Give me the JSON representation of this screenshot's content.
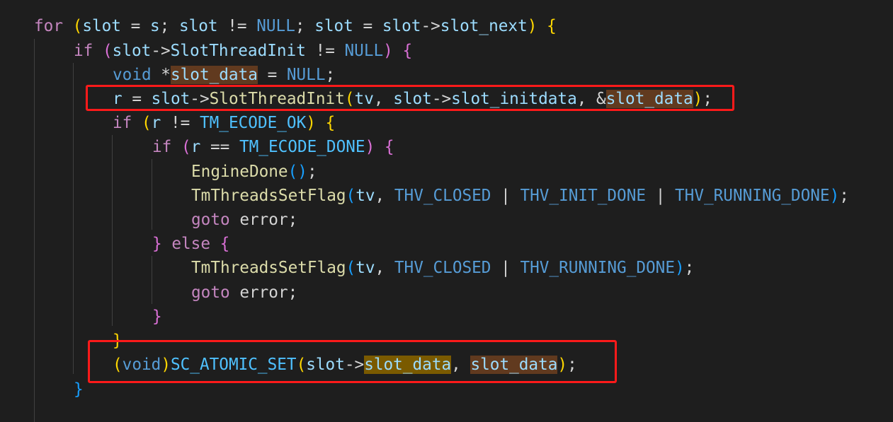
{
  "editor": {
    "theme_colors": {
      "background": "#1e1e1e",
      "keyword_control": "#c586c0",
      "keyword": "#569cd6",
      "identifier": "#9cdcfe",
      "function": "#dcdcaa",
      "highlight_box": "#ff1a1a",
      "reference_highlight": "#613a1f"
    },
    "lines": [
      {
        "tokens": [
          "for",
          " ",
          "(",
          "slot",
          " = ",
          "s",
          "; ",
          "slot",
          " != ",
          "NULL",
          "; ",
          "slot",
          " = ",
          "slot",
          "->",
          "slot_next",
          ")",
          " ",
          "{"
        ]
      },
      {
        "tokens": [
          "if",
          " ",
          "(",
          "slot",
          "->",
          "SlotThreadInit",
          " != ",
          "NULL",
          ")",
          " ",
          "{"
        ]
      },
      {
        "tokens": [
          "void",
          " *",
          "slot_data",
          " = ",
          "NULL",
          ";"
        ]
      },
      {
        "tokens": [
          "r",
          " = ",
          "slot",
          "->",
          "SlotThreadInit",
          "(",
          "tv",
          ", ",
          "slot",
          "->",
          "slot_initdata",
          ", &",
          "slot_data",
          ")",
          ";"
        ]
      },
      {
        "tokens": [
          "if",
          " ",
          "(",
          "r",
          " != ",
          "TM_ECODE_OK",
          ")",
          " ",
          "{"
        ]
      },
      {
        "tokens": [
          "if",
          " ",
          "(",
          "r",
          " == ",
          "TM_ECODE_DONE",
          ")",
          " ",
          "{"
        ]
      },
      {
        "tokens": [
          "EngineDone",
          "(",
          ")",
          ";"
        ]
      },
      {
        "tokens": [
          "TmThreadsSetFlag",
          "(",
          "tv",
          ", ",
          "THV_CLOSED",
          " | ",
          "THV_INIT_DONE",
          " | ",
          "THV_RUNNING_DONE",
          ")",
          ";"
        ]
      },
      {
        "tokens": [
          "goto",
          " ",
          "error",
          ";"
        ]
      },
      {
        "tokens": [
          "}",
          " ",
          "else",
          " ",
          "{"
        ]
      },
      {
        "tokens": [
          "TmThreadsSetFlag",
          "(",
          "tv",
          ", ",
          "THV_CLOSED",
          " | ",
          "THV_RUNNING_DONE",
          ")",
          ";"
        ]
      },
      {
        "tokens": [
          "goto",
          " ",
          "error",
          ";"
        ]
      },
      {
        "tokens": [
          "}"
        ]
      },
      {
        "tokens": [
          "}"
        ]
      },
      {
        "tokens": [
          "(",
          "void",
          ")",
          "SC_ATOMIC_SET",
          "(",
          "slot",
          "->",
          "slot_data",
          ", ",
          "slot_data",
          ")",
          ";"
        ]
      },
      {
        "tokens": [
          "}"
        ]
      }
    ]
  }
}
